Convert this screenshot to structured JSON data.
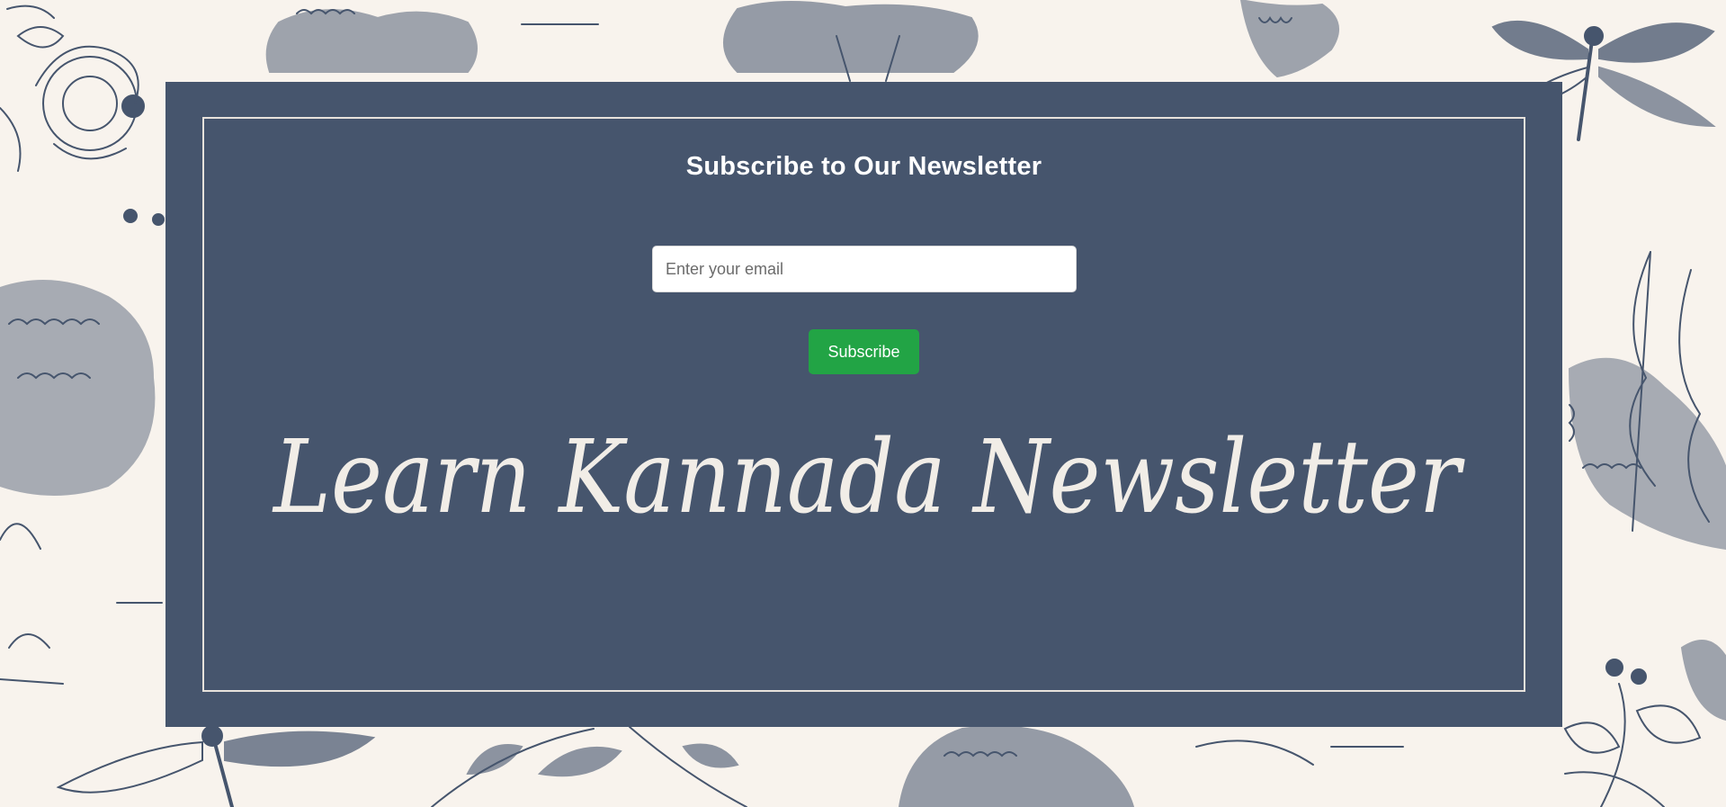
{
  "newsletter": {
    "heading": "Subscribe to Our Newsletter",
    "email_placeholder": "Enter your email",
    "email_value": "",
    "subscribe_label": "Subscribe",
    "script_title": "Learn Kannada Newsletter"
  },
  "colors": {
    "page_background": "#f8f3ed",
    "panel": "#46556d",
    "frame_line": "#e7e2dc",
    "illustration_ink": "#46556d",
    "button": "#22a445",
    "text_light": "#ffffff"
  },
  "icons": {
    "decorations": [
      "flower-illustration",
      "tree-illustration",
      "dragonfly-illustration",
      "berry-branch-illustration",
      "leaf-branch-illustration"
    ]
  }
}
